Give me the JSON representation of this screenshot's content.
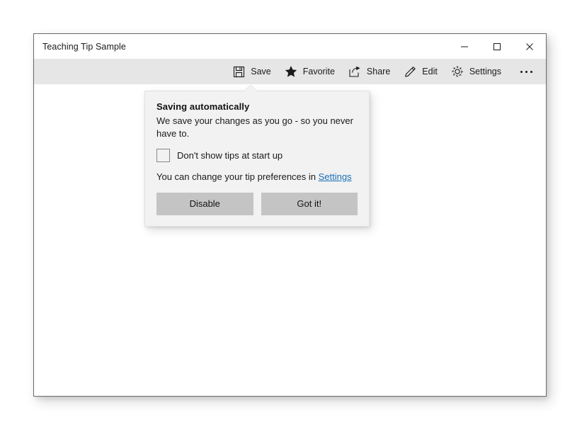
{
  "window": {
    "title": "Teaching Tip Sample",
    "caption": {
      "minimize": "minimize-icon",
      "maximize": "maximize-icon",
      "close": "close-icon"
    }
  },
  "commandbar": {
    "items": [
      {
        "icon": "save-icon",
        "label": "Save"
      },
      {
        "icon": "star-icon",
        "label": "Favorite"
      },
      {
        "icon": "share-icon",
        "label": "Share"
      },
      {
        "icon": "pencil-icon",
        "label": "Edit"
      },
      {
        "icon": "gear-icon",
        "label": "Settings"
      }
    ],
    "overflow": "more-icon"
  },
  "teaching_tip": {
    "title": "Saving automatically",
    "subtitle": "We save your changes as you go - so you never have to.",
    "checkbox": {
      "label": "Don't show tips at start up",
      "checked": false
    },
    "preference_text": "You can change your tip preferences in ",
    "preference_link": "Settings",
    "buttons": {
      "secondary": "Disable",
      "primary": "Got it!"
    }
  },
  "colors": {
    "command_bar": "#e6e6e6",
    "tip_surface": "#f2f2f2",
    "tip_button": "#c4c4c4",
    "link": "#1a6fb5",
    "window_border": "#6b6b6b"
  }
}
